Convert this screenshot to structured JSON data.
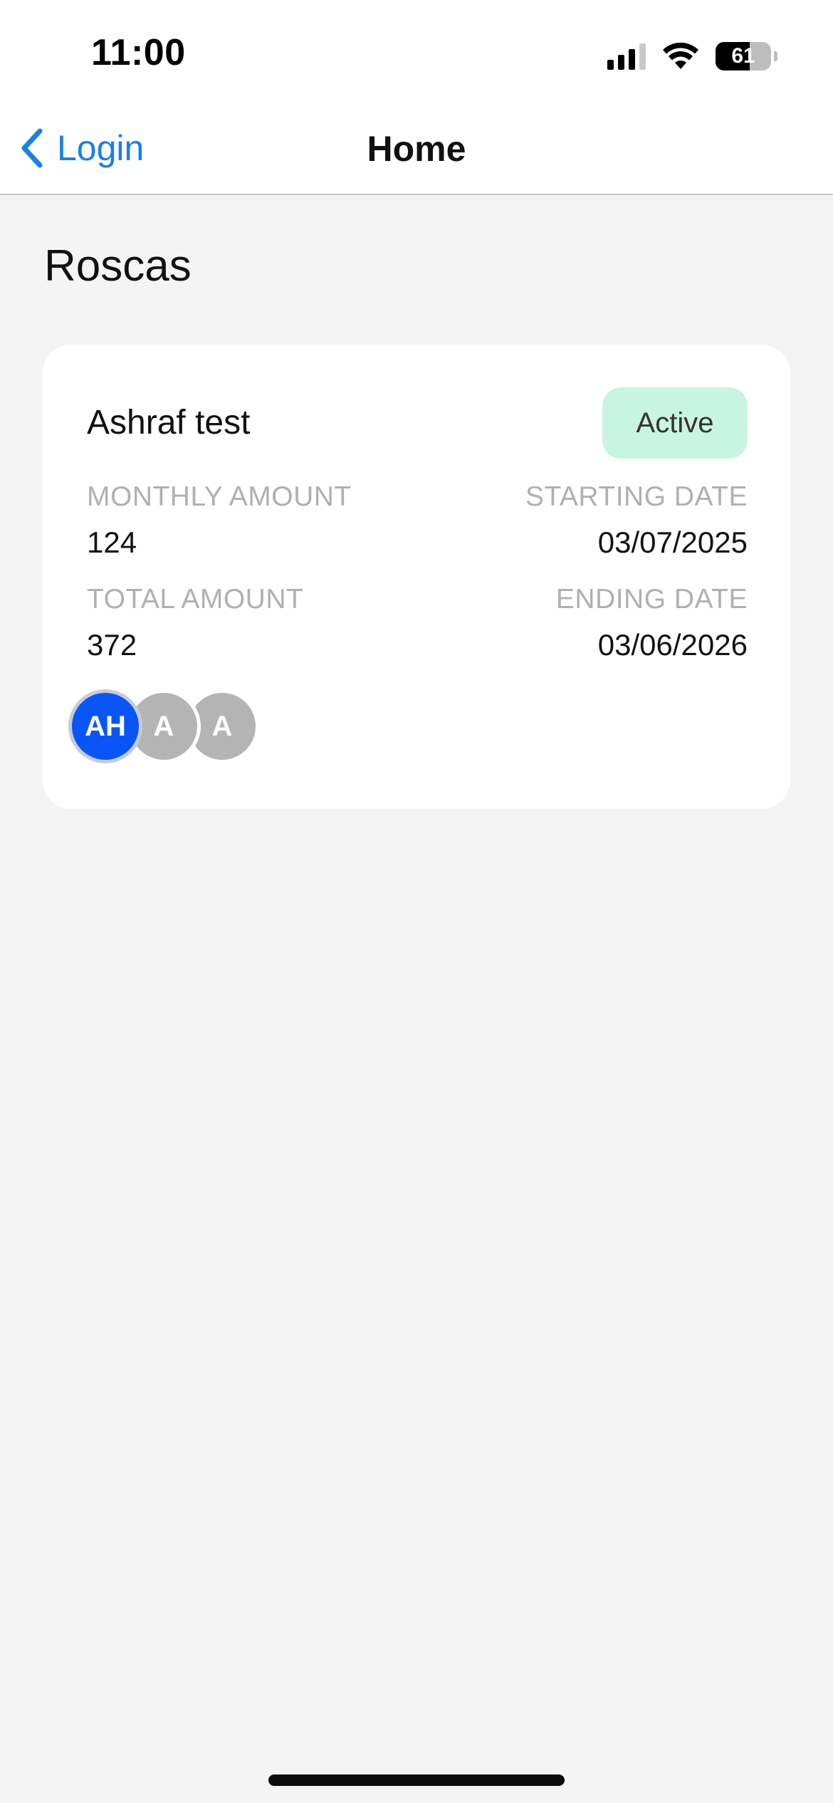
{
  "status_bar": {
    "time": "11:00",
    "battery": "61",
    "battery_level": 0.61
  },
  "nav": {
    "back_label": "Login",
    "title": "Home"
  },
  "section_title": "Roscas",
  "rosca": {
    "name": "Ashraf test",
    "status": "Active",
    "monthly_amount_label": "MONTHLY AMOUNT",
    "monthly_amount": "124",
    "starting_date_label": "STARTING DATE",
    "starting_date": "03/07/2025",
    "total_amount_label": "TOTAL AMOUNT",
    "total_amount": "372",
    "ending_date_label": "ENDING DATE",
    "ending_date": "03/06/2026",
    "members": [
      "AH",
      "A",
      "A"
    ]
  },
  "colors": {
    "accent": "#1a7fe8",
    "badge_bg": "#c8f5e1",
    "avatar_primary": "#0a56f5",
    "avatar_secondary": "#b4b4b4"
  }
}
